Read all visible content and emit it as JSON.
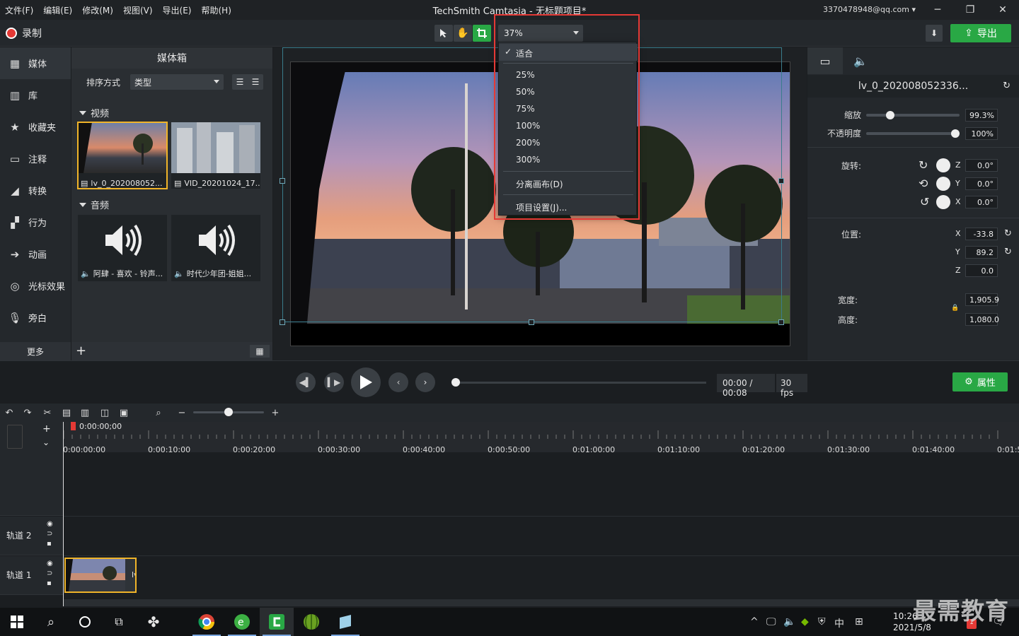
{
  "menu": [
    "文件(F)",
    "编辑(E)",
    "修改(M)",
    "视图(V)",
    "导出(E)",
    "帮助(H)"
  ],
  "window_title": "TechSmith Camtasia - 无标题项目*",
  "account": "3370478948@qq.com",
  "toolbar": {
    "record_label": "录制",
    "zoom_value": "37%",
    "export_label": "导出"
  },
  "zoom_menu": {
    "items": [
      "适合",
      "25%",
      "50%",
      "75%",
      "100%",
      "200%",
      "300%",
      "分离画布(D)",
      "项目设置(J)..."
    ],
    "checked": "适合"
  },
  "sidebar": {
    "items": [
      "媒体",
      "库",
      "收藏夹",
      "注释",
      "转换",
      "行为",
      "动画",
      "光标效果",
      "旁白"
    ],
    "more": "更多"
  },
  "media_bin": {
    "title": "媒体箱",
    "sort_label": "排序方式",
    "sort_value": "类型",
    "video_section": "视频",
    "audio_section": "音频",
    "videos": [
      "lv_0_202008052...",
      "VID_20201024_17..."
    ],
    "audios": [
      "阿肆 - 喜欢 - 铃声...",
      "时代少年团-姐姐..."
    ]
  },
  "properties": {
    "title": "lv_0_20200805233б...",
    "title_text": "lv_0_202008052336...",
    "scale_label": "缩放",
    "scale_value": "99.3%",
    "scale_fraction": 0.23,
    "opacity_label": "不透明度",
    "opacity_value": "100%",
    "opacity_fraction": 1.0,
    "rotation_label": "旋转:",
    "rot_z": "0.0°",
    "rot_y": "0.0°",
    "rot_x": "0.0°",
    "axis_z": "Z",
    "axis_y": "Y",
    "axis_x": "X",
    "position_label": "位置:",
    "pos_x": "-33.8",
    "pos_y": "89.2",
    "pos_z": "0.0",
    "width_label": "宽度:",
    "width_value": "1,905.9",
    "height_label": "高度:",
    "height_value": "1,080.0"
  },
  "playback": {
    "time": "00:00 / 00:08",
    "fps": "30 fps",
    "properties_label": "属性"
  },
  "timeline": {
    "playhead": "0:00:00;00",
    "ticks": [
      "0:00:00;00",
      "0:00:10;00",
      "0:00:20;00",
      "0:00:30;00",
      "0:00:40;00",
      "0:00:50;00",
      "0:01:00;00",
      "0:01:10;00",
      "0:01:20;00",
      "0:01:30;00",
      "0:01:40;00",
      "0:01:5"
    ],
    "tracks": [
      "轨道 2",
      "轨道 1"
    ],
    "clip_label": "lv"
  },
  "taskbar": {
    "time": "10:26",
    "date": "2021/5/8",
    "ime": "中",
    "notif_count": "1"
  },
  "watermark": "最需教育",
  "colors": {
    "accent": "#29a845",
    "highlight": "#e53935",
    "selection": "#f0b429"
  }
}
